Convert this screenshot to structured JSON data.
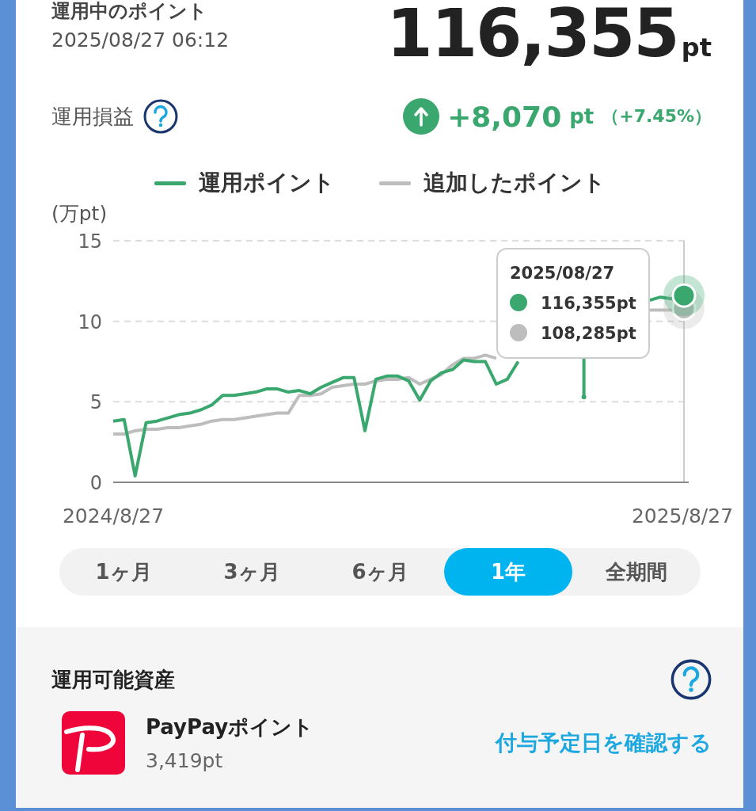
{
  "summary": {
    "title": "運用中のポイント",
    "timestamp": "2025/08/27 06:12",
    "total": "116,355",
    "total_unit": "pt",
    "profit_label": "運用損益",
    "profit_value": "+8,070",
    "profit_unit": "pt",
    "profit_percent": "（+7.45%）"
  },
  "chart": {
    "chart_data": {
      "type": "line",
      "ylabel": "(万pt)",
      "ylim": [
        0,
        15
      ],
      "yticks": [
        0,
        5,
        10,
        15
      ],
      "categories": [
        "2024/8/27",
        null,
        null,
        null,
        null,
        null,
        null,
        null,
        null,
        null,
        null,
        null,
        null,
        null,
        null,
        null,
        null,
        null,
        null,
        null,
        null,
        null,
        null,
        null,
        null,
        null,
        null,
        null,
        null,
        null,
        null,
        null,
        null,
        null,
        null,
        null,
        null,
        null,
        null,
        null,
        null,
        null,
        null,
        null,
        null,
        null,
        null,
        null,
        null,
        null,
        null,
        null,
        "2025/8/27"
      ],
      "series": [
        {
          "name": "運用ポイント",
          "color": "#3aa86e",
          "values": [
            3.8,
            3.9,
            0.4,
            3.7,
            3.8,
            4.0,
            4.2,
            4.3,
            4.5,
            4.8,
            5.4,
            5.4,
            5.5,
            5.6,
            5.8,
            5.8,
            5.6,
            5.7,
            5.5,
            5.9,
            6.2,
            6.5,
            6.5,
            3.2,
            6.4,
            6.6,
            6.6,
            6.3,
            5.1,
            6.3,
            6.8,
            7.0,
            7.6,
            7.5,
            7.5,
            6.1,
            6.4,
            7.5,
            null,
            null,
            null,
            null,
            null,
            5.3,
            null,
            null,
            null,
            null,
            null,
            11.3,
            11.5,
            11.4,
            11.6
          ]
        },
        {
          "name": "追加したポイント",
          "color": "#bdbdbd",
          "values": [
            3.0,
            3.0,
            3.2,
            3.3,
            3.3,
            3.4,
            3.4,
            3.5,
            3.6,
            3.8,
            3.9,
            3.9,
            4.0,
            4.1,
            4.2,
            4.3,
            4.3,
            5.4,
            5.4,
            5.5,
            5.9,
            6.0,
            6.1,
            6.1,
            6.3,
            6.4,
            6.4,
            6.5,
            6.1,
            6.4,
            6.7,
            7.3,
            7.7,
            7.7,
            7.9,
            7.7,
            null,
            null,
            null,
            null,
            null,
            null,
            null,
            null,
            null,
            null,
            null,
            null,
            null,
            10.7,
            10.7,
            10.7,
            10.8
          ]
        }
      ]
    },
    "tooltip": {
      "date": "2025/08/27",
      "items": [
        {
          "value": "116,355pt",
          "color": "#3aa86e"
        },
        {
          "value": "108,285pt",
          "color": "#bdbdbd"
        }
      ]
    }
  },
  "periods": [
    {
      "label": "1ヶ月",
      "selected": false
    },
    {
      "label": "3ヶ月",
      "selected": false
    },
    {
      "label": "6ヶ月",
      "selected": false
    },
    {
      "label": "1年",
      "selected": true
    },
    {
      "label": "全期間",
      "selected": false
    }
  ],
  "assets": {
    "title": "運用可能資産",
    "name": "PayPayポイント",
    "amount": "3,419pt",
    "link": "付与予定日を確認する"
  }
}
